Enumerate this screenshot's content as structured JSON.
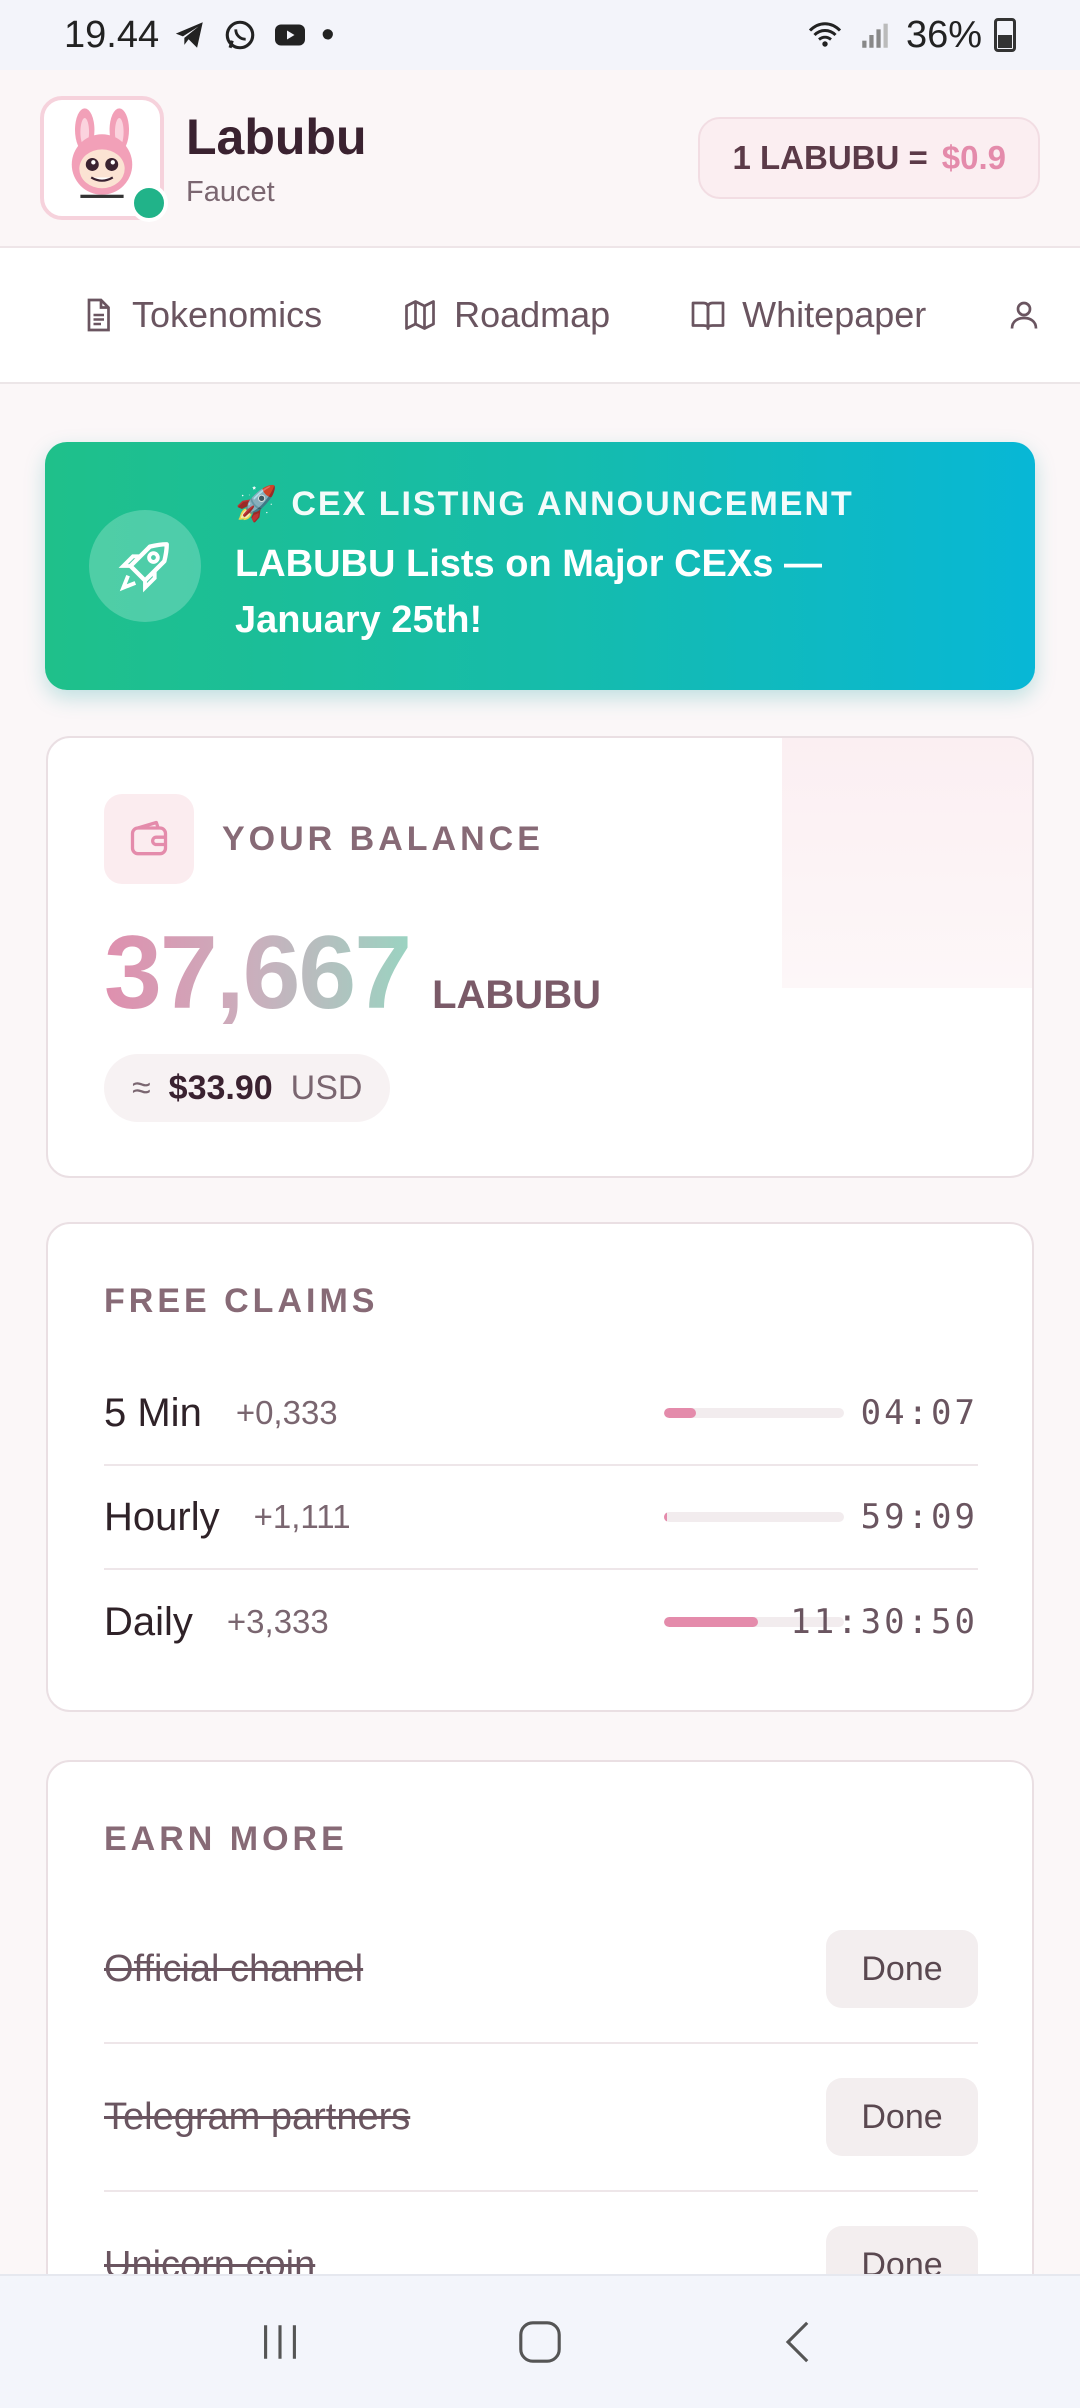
{
  "status_bar": {
    "time": "19.44",
    "dot": "•",
    "battery_percent": "36%"
  },
  "header": {
    "app_name": "Labubu",
    "app_sub": "Faucet",
    "price_label": "1 LABUBU =",
    "price_value": "$0.9"
  },
  "nav": {
    "items": [
      {
        "label": "Tokenomics",
        "icon": "document-icon"
      },
      {
        "label": "Roadmap",
        "icon": "map-icon"
      },
      {
        "label": "Whitepaper",
        "icon": "book-icon"
      }
    ]
  },
  "announcement": {
    "kicker": "CEX LISTING ANNOUNCEMENT",
    "title": "LABUBU Lists on Major CEXs — January 25th!"
  },
  "balance": {
    "label": "YOUR BALANCE",
    "amount": "37,667",
    "unit": "LABUBU",
    "approx": "≈",
    "usd_value": "$33.90",
    "usd_currency": "USD"
  },
  "claims": {
    "title": "FREE CLAIMS",
    "rows": [
      {
        "name": "5 Min",
        "amount": "+0,333",
        "time": "04:07",
        "progress": 0.18
      },
      {
        "name": "Hourly",
        "amount": "+1,111",
        "time": "59:09",
        "progress": 0.01
      },
      {
        "name": "Daily",
        "amount": "+3,333",
        "time": "11:30:50",
        "progress": 0.52
      }
    ]
  },
  "earn": {
    "title": "EARN MORE",
    "tasks": [
      {
        "name": "Official channel",
        "button": "Done"
      },
      {
        "name": "Telegram partners",
        "button": "Done"
      },
      {
        "name": "Unicorn coin",
        "button": "Done"
      }
    ]
  },
  "colors": {
    "accent_pink": "#e48bab",
    "banner_start": "#1fc08a",
    "banner_end": "#08b7d6",
    "online": "#21b389"
  }
}
